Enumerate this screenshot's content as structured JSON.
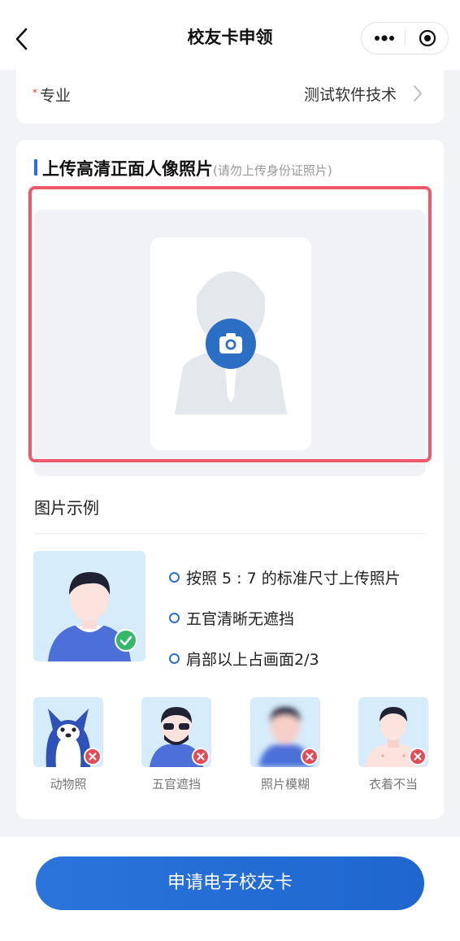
{
  "nav": {
    "title": "校友卡申领"
  },
  "major": {
    "required_mark": "*",
    "label": "专业",
    "value": "测试软件技术"
  },
  "upload": {
    "title": "上传高清正面人像照片",
    "note": "(请勿上传身份证照片)"
  },
  "examples": {
    "title": "图片示例",
    "rules": [
      "按照 5 : 7 的标准尺寸上传照片",
      "五官清晰无遮挡",
      "肩部以上占画面2/3"
    ],
    "bad": [
      {
        "caption": "动物照",
        "icon": "animal-photo-icon"
      },
      {
        "caption": "五官遮挡",
        "icon": "sunglasses-photo-icon"
      },
      {
        "caption": "照片模糊",
        "icon": "blurry-photo-icon"
      },
      {
        "caption": "衣着不当",
        "icon": "shirtless-photo-icon"
      }
    ]
  },
  "submit": {
    "label": "申请电子校友卡"
  },
  "colors": {
    "accent": "#2a6fd1",
    "highlight": "#ef5a6a",
    "error": "#e24b58",
    "success": "#35b86a"
  }
}
